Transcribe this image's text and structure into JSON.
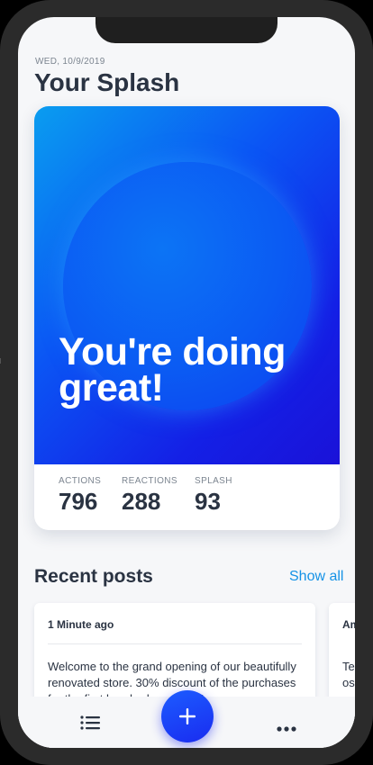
{
  "header": {
    "date": "WED, 10/9/2019",
    "title": "Your Splash"
  },
  "hero": {
    "message": "You're doing great!"
  },
  "stats": [
    {
      "label": "ACTIONS",
      "value": "796"
    },
    {
      "label": "REACTIONS",
      "value": "288"
    },
    {
      "label": "SPLASH",
      "value": "93"
    }
  ],
  "recent": {
    "title": "Recent posts",
    "show_all": "Show all"
  },
  "posts": [
    {
      "time": "1 Minute ago",
      "body": "Welcome to the grand opening of our beautifully renovated store. 30% discount of the purchases for the first hundred customer!"
    },
    {
      "time": "Am",
      "body": "Te os"
    }
  ],
  "nav": {
    "list_icon": "list-icon",
    "add_icon": "plus-icon",
    "more_icon": "more-icon"
  },
  "colors": {
    "accent": "#1592e6",
    "primary_text": "#2a3342",
    "fab": "#1a2cf0"
  }
}
